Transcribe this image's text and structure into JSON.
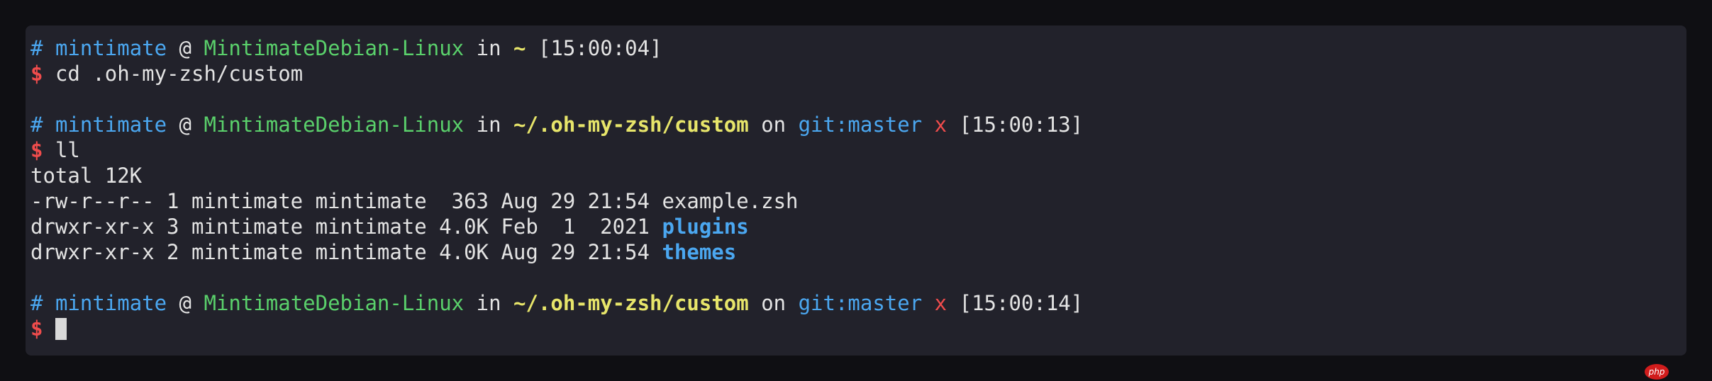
{
  "prompts": [
    {
      "hash": "#",
      "user": "mintimate",
      "at": "@",
      "host": "MintimateDebian-Linux",
      "in": "in",
      "path": "~",
      "on": "",
      "git_branch": "",
      "dirty_mark": "",
      "time": "[15:00:04]",
      "dollar": "$",
      "command": "cd .oh-my-zsh/custom"
    },
    {
      "hash": "#",
      "user": "mintimate",
      "at": "@",
      "host": "MintimateDebian-Linux",
      "in": "in",
      "path": "~/.oh-my-zsh/custom",
      "on": "on",
      "git_branch": "git:master",
      "dirty_mark": "x",
      "time": "[15:00:13]",
      "dollar": "$",
      "command": "ll"
    },
    {
      "hash": "#",
      "user": "mintimate",
      "at": "@",
      "host": "MintimateDebian-Linux",
      "in": "in",
      "path": "~/.oh-my-zsh/custom",
      "on": "on",
      "git_branch": "git:master",
      "dirty_mark": "x",
      "time": "[15:00:14]",
      "dollar": "$",
      "command": ""
    }
  ],
  "listing": {
    "total": "total 12K",
    "rows": [
      {
        "meta": "-rw-r--r-- 1 mintimate mintimate  363 Aug 29 21:54 ",
        "name": "example.zsh",
        "is_dir": false
      },
      {
        "meta": "drwxr-xr-x 3 mintimate mintimate 4.0K Feb  1  2021 ",
        "name": "plugins",
        "is_dir": true
      },
      {
        "meta": "drwxr-xr-x 2 mintimate mintimate 4.0K Aug 29 21:54 ",
        "name": "themes",
        "is_dir": true
      }
    ]
  },
  "watermark": "php",
  "colors": {
    "background": "#0f0f13",
    "terminal_bg": "#22222b",
    "user": "#4ba7f0",
    "host": "#5ad06b",
    "path": "#e7e56a",
    "git": "#4ba7f0",
    "dirty": "#f04c4c",
    "dollar": "#f04c4c",
    "directory": "#4ba7f0",
    "text": "#e3e3e3"
  }
}
